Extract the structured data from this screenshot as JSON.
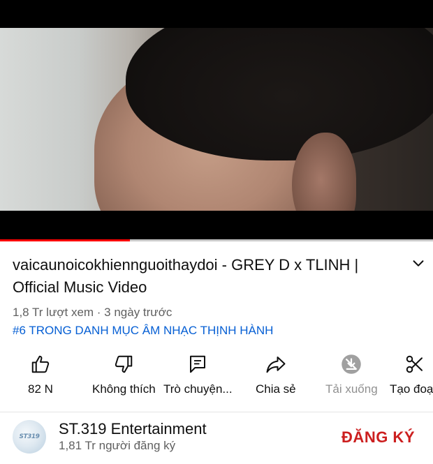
{
  "video": {
    "title": "vaicaunoicokhiennguoithaydoi - GREY D x TLINH | Official Music Video",
    "meta": "1,8 Tr lượt xem · 3 ngày trước",
    "trending_tag": "#6 TRONG DANH MỤC ÂM NHẠC THỊNH HÀNH",
    "progress_fraction": 0.3
  },
  "actions": [
    {
      "name": "like",
      "label": "82 N",
      "icon": "thumbs-up-icon"
    },
    {
      "name": "dislike",
      "label": "Không thích",
      "icon": "thumbs-down-icon"
    },
    {
      "name": "comments",
      "label": "Trò chuyện...",
      "icon": "chat-icon"
    },
    {
      "name": "share",
      "label": "Chia sẻ",
      "icon": "share-icon"
    },
    {
      "name": "download",
      "label": "Tải xuống",
      "icon": "download-disabled-icon"
    },
    {
      "name": "clip",
      "label": "Tạo đoạn",
      "icon": "scissors-icon"
    }
  ],
  "channel": {
    "name": "ST.319 Entertainment",
    "subscribers": "1,81 Tr người đăng ký",
    "subscribe_label": "ĐĂNG KÝ",
    "avatar_text": "ST319"
  },
  "colors": {
    "progress": "#ff0000",
    "link": "#065fd4",
    "subscribe": "#cc1f1f",
    "secondary_text": "#606060"
  }
}
